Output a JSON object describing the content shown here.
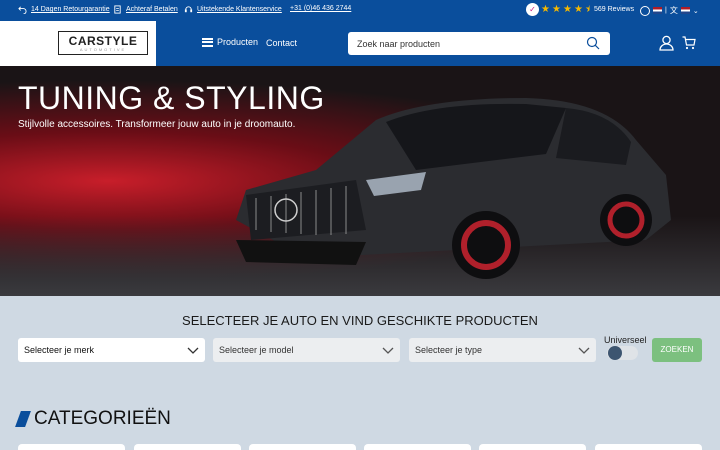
{
  "topbar": {
    "usps": [
      "14 Dagen Retourgarantie",
      "Achteraf Betalen",
      "Uitstekende Klantenservice",
      "+31 (0)46 436 2744"
    ],
    "rating": {
      "stars": 4.5,
      "max_stars": 5,
      "reviews": "569 Reviews"
    },
    "language_separator": "|"
  },
  "header": {
    "logo_main": "CARSTYLE",
    "logo_sub": "AUTOMOTIVE",
    "nav_products": "Producten",
    "nav_contact": "Contact",
    "search_placeholder": "Zoek naar producten"
  },
  "hero": {
    "title": "TUNING & STYLING",
    "subtitle": "Stijlvolle accessoires. Transformeer jouw auto in je droomauto."
  },
  "selector": {
    "title": "SELECTEER JE AUTO EN VIND GESCHIKTE PRODUCTEN",
    "brand": "Selecteer je merk",
    "model": "Selecteer je model",
    "type": "Selecteer je type",
    "universal_label": "Universeel",
    "universal_on": false,
    "search_button": "ZOEKEN"
  },
  "categories": {
    "title": "CATEGORIEËN",
    "card_count": 6
  },
  "colors": {
    "brand_blue": "#0a4e9c",
    "search_green": "#7cc07f",
    "star_yellow": "#f5b800"
  }
}
